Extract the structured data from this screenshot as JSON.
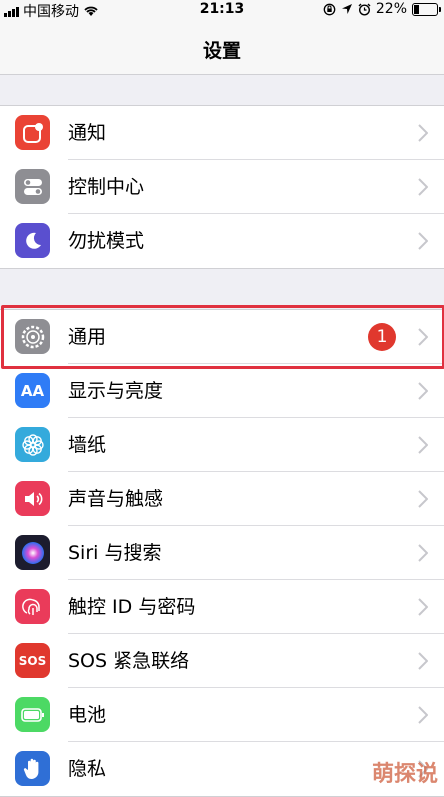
{
  "status_bar": {
    "carrier": "中国移动",
    "time": "21:13",
    "battery": "22%",
    "battery_level": 0.22
  },
  "nav": {
    "title": "设置"
  },
  "group1": [
    {
      "label": "通知",
      "icon": "notifications-icon",
      "color": "#ea4335"
    },
    {
      "label": "控制中心",
      "icon": "control-center-icon",
      "color": "#8e8e93"
    },
    {
      "label": "勿扰模式",
      "icon": "moon-icon",
      "color": "#5a4fcf"
    }
  ],
  "group2": [
    {
      "label": "通用",
      "icon": "gear-icon",
      "color": "#8e8e93",
      "badge": "1"
    },
    {
      "label": "显示与亮度",
      "icon": "display-brightness-icon",
      "color": "#2f7cf6",
      "icon_text": "AA"
    },
    {
      "label": "墙纸",
      "icon": "wallpaper-icon",
      "color": "#34aadc"
    },
    {
      "label": "声音与触感",
      "icon": "sound-icon",
      "color": "#ea3b5a"
    },
    {
      "label": "Siri 与搜索",
      "icon": "siri-icon",
      "color": "#1c1c2e"
    },
    {
      "label": "触控 ID 与密码",
      "icon": "fingerprint-icon",
      "color": "#ea3b5a"
    },
    {
      "label": "SOS 紧急联络",
      "icon": "sos-icon",
      "color": "#e0382e",
      "icon_text": "SOS"
    },
    {
      "label": "电池",
      "icon": "battery-icon",
      "color": "#4cd964"
    },
    {
      "label": "隐私",
      "icon": "hand-icon",
      "color": "#2f6fd6"
    }
  ],
  "watermark": "萌探说"
}
